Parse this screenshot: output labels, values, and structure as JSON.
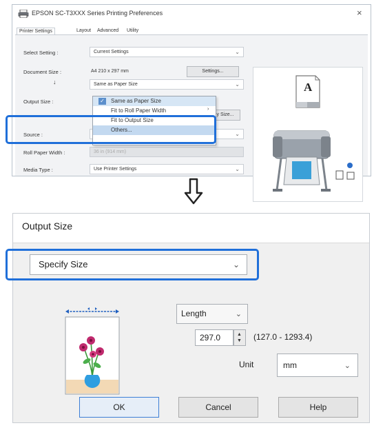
{
  "top_window": {
    "title": "EPSON SC-T3XXX Series Printing Preferences",
    "close_glyph": "×",
    "tabs": [
      "Printer Settings",
      "Layout",
      "Advanced",
      "Utility"
    ],
    "rows": {
      "select_setting": {
        "label": "Select Setting :",
        "value": "Current Settings"
      },
      "document_size": {
        "label": "Document Size :",
        "value": "A4 210 x 297 mm",
        "button": "Settings..."
      },
      "arrow_glyph": "↓",
      "same_as_combo": "Same as Paper Size",
      "output_size": {
        "label": "Output Size :",
        "button_fragment": "y Size..."
      },
      "source": {
        "label": "Source :"
      },
      "roll_paper_width": {
        "label": "Roll Paper Width :",
        "value": "36 in (914 mm)"
      },
      "media_type": {
        "label": "Media Type :",
        "value": "Use Printer Settings"
      }
    },
    "dropdown_items": [
      "Same as Paper Size",
      "Fit to Roll Paper Width",
      "Fit to Output Size",
      "Others..."
    ],
    "preview_letter": "A"
  },
  "dialog": {
    "title": "Output Size",
    "size_value": "Specify Size",
    "length_value": "Length",
    "length_input": "297.0",
    "range": "(127.0 - 1293.4)",
    "unit_label": "Unit",
    "unit_value": "mm",
    "buttons": {
      "ok": "OK",
      "cancel": "Cancel",
      "help": "Help"
    }
  },
  "colors": {
    "highlight": "#1f6fd9"
  },
  "icons": [
    "printer-icon",
    "close-icon",
    "chevron-down-icon",
    "check-icon",
    "down-arrow-icon",
    "spinner-up-icon",
    "spinner-down-icon",
    "flower-vase-image",
    "plotter-image"
  ]
}
